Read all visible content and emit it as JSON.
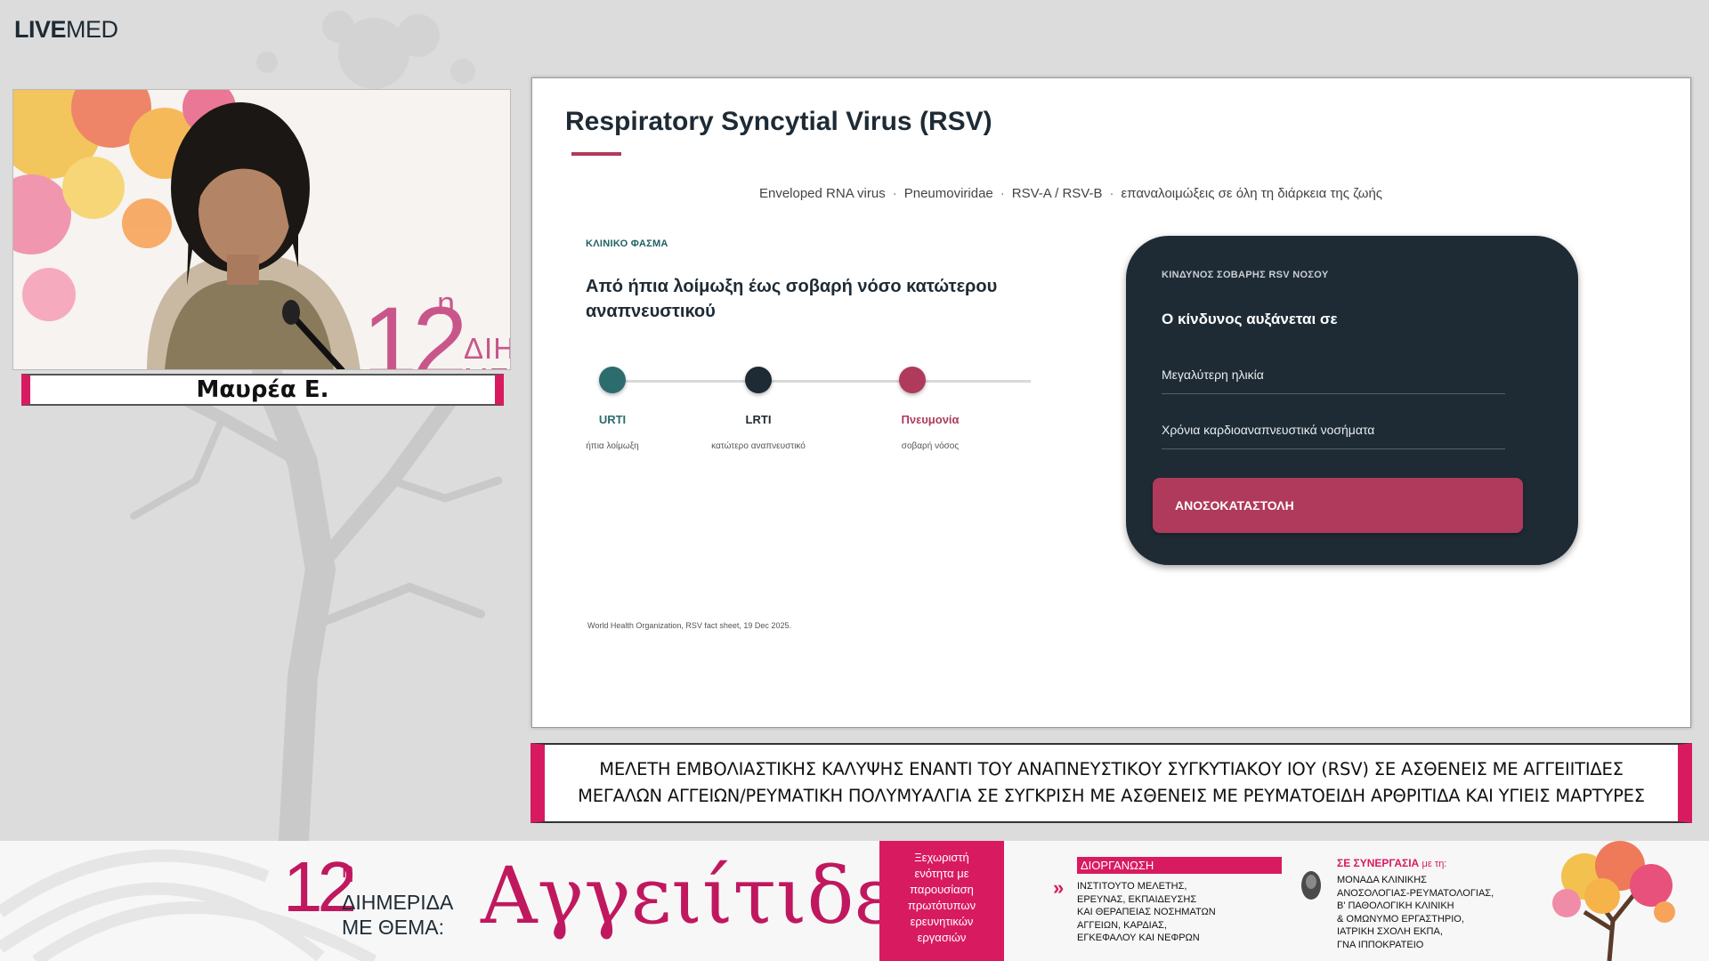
{
  "logo": {
    "bold": "LIVE",
    "light": "MED"
  },
  "video": {
    "event_number": "12",
    "event_sup": "n",
    "event_word1": "ΔΙΗΜ",
    "event_word2": "ΜΕ"
  },
  "speaker": {
    "name": "Μαυρέα Ε."
  },
  "slide": {
    "title": "Respiratory Syncytial Virus (RSV)",
    "subtitle": {
      "items": [
        "Enveloped RNA virus",
        "Pneumoviridae",
        "RSV-A / RSV-B",
        "επαναλοιμώξεις σε όλη τη διάρκεια της ζωής"
      ],
      "separator": "·"
    },
    "spectrum": {
      "label": "ΚΛΙΝΙΚΟ ΦΑΣΜΑ",
      "heading": "Από ήπια λοίμωξη έως σοβαρή νόσο κατώτερου αναπνευστικού",
      "stages": [
        {
          "name": "URTI",
          "desc": "ήπια λοίμωξη",
          "color": "#2c6b6e"
        },
        {
          "name": "LRTI",
          "desc": "κατώτερο αναπνευστικό",
          "color": "#1e2b35"
        },
        {
          "name": "Πνευμονία",
          "desc": "σοβαρή νόσος",
          "color": "#b03a5b"
        }
      ]
    },
    "risk": {
      "label": "ΚΙΝΔΥΝΟΣ ΣΟΒΑΡΗΣ RSV ΝΟΣΟΥ",
      "heading": "Ο κίνδυνος αυξάνεται σε",
      "items": [
        "Μεγαλύτερη ηλικία",
        "Χρόνια καρδιοαναπνευστικά νοσήματα"
      ],
      "highlight": "ΑΝΟΣΟΚΑΤΑΣΤΟΛΗ"
    },
    "source": "World Health Organization, RSV fact sheet, 19 Dec 2025."
  },
  "caption": {
    "line1": "ΜΕΛΕΤΗ ΕΜΒΟΛΙΑΣΤΙΚΗΣ ΚΑΛΥΨΗΣ ΕΝΑΝΤΙ ΤΟΥ ΑΝΑΠΝΕΥΣΤΙΚΟΥ ΣΥΓΚΥΤΙΑΚΟΥ ΙΟΥ (RSV) ΣΕ ΑΣΘΕΝΕΙΣ ΜΕ ΑΓΓΕΙΙΤΙΔΕΣ",
    "line2": "ΜΕΓΑΛΩΝ ΑΓΓΕΙΩΝ/ΡΕΥΜΑΤΙΚΗ ΠΟΛΥΜΥΑΛΓΙΑ ΣΕ ΣΥΓΚΡΙΣΗ ΜΕ ΑΣΘΕΝΕΙΣ ΜΕ ΡΕΥΜΑΤΟΕΙΔΗ ΑΡΘΡΙΤΙΔΑ ΚΑΙ ΥΓΙΕΙΣ ΜΑΡΤΥΡΕΣ"
  },
  "banner": {
    "number": "12",
    "sup": "η",
    "word1": "ΔΙΗΜΕΡΙΔΑ",
    "word2": "ΜΕ ΘΕΜΑ:",
    "title": "Αγγειίτιδες",
    "pink_box": [
      "Ξεχωριστή",
      "ενότητα με",
      "παρουσίαση",
      "πρωτότυπων",
      "ερευνητικών",
      "εργασιών"
    ],
    "org_label": "ΔΙΟΡΓΑΝΩΣΗ",
    "org_lines": [
      "ΙΝΣΤΙΤΟΥΤΟ ΜΕΛΕΤΗΣ,",
      "ΕΡΕΥΝΑΣ, ΕΚΠΑΙΔΕΥΣΗΣ",
      "ΚΑΙ ΘΕΡΑΠΕΙΑΣ ΝΟΣΗΜΑΤΩΝ",
      "ΑΓΓΕΙΩΝ, ΚΑΡΔΙΑΣ,",
      "ΕΓΚΕΦΑΛΟΥ ΚΑΙ ΝΕΦΡΩΝ"
    ],
    "syn_label": "ΣΕ ΣΥΝΕΡΓΑΣΙΑ",
    "syn_label_small": "με τη:",
    "syn_lines": [
      "ΜΟΝΑΔΑ ΚΛΙΝΙΚΗΣ",
      "ΑΝΟΣΟΛΟΓΙΑΣ-ΡΕΥΜΑΤΟΛΟΓΙΑΣ,",
      "Β' ΠΑΘΟΛΟΓΙΚΗ ΚΛΙΝΙΚΗ",
      "& ΟΜΩΝΥΜΟ ΕΡΓΑΣΤΗΡΙΟ,",
      "ΙΑΤΡΙΚΗ ΣΧΟΛΗ ΕΚΠΑ,",
      "ΓΝΑ ΙΠΠΟΚΡΑΤΕΙΟ"
    ]
  },
  "colors": {
    "accent_pink": "#d81b60",
    "slide_rose": "#b03a5b",
    "slide_navy": "#1e2b35",
    "slide_teal": "#2c6b6e"
  }
}
